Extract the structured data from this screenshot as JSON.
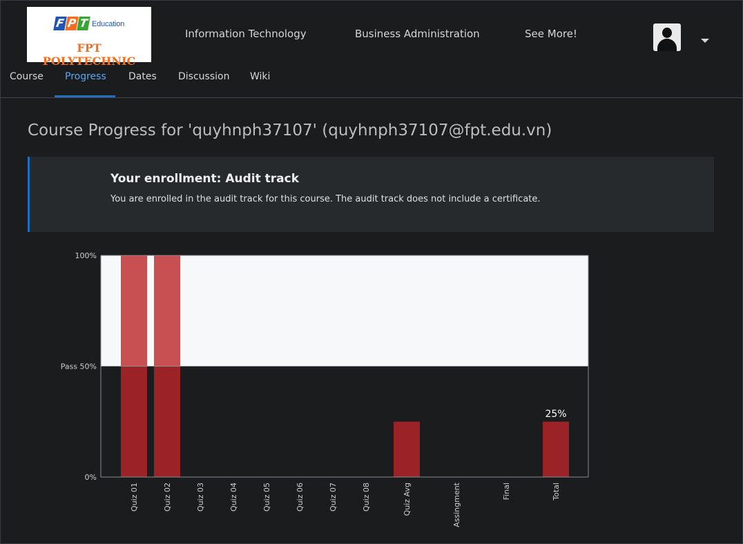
{
  "brand": {
    "letters": [
      "F",
      "P",
      "T"
    ],
    "letter_colors": [
      "#1f56b5",
      "#f26f21",
      "#3aa335"
    ],
    "education": "Education",
    "polytechnic": "FPT POLYTECHNIC"
  },
  "topnav": {
    "links": [
      "Information Technology",
      "Business Administration",
      "See More!"
    ]
  },
  "course_tabs": {
    "items": [
      "Course",
      "Progress",
      "Dates",
      "Discussion",
      "Wiki"
    ],
    "active": "Progress"
  },
  "page": {
    "title": "Course Progress for 'quyhnph37107' (quyhnph37107@fpt.edu.vn)"
  },
  "enrollment": {
    "heading": "Your enrollment: Audit track",
    "message": "You are enrolled in the audit track for this course. The audit track does not include a certificate."
  },
  "colors": {
    "accent": "#1e6fbf",
    "bar": "#9b2226",
    "bar_above_pass": "#c85052",
    "pass_area": "#f7f8f9"
  },
  "chart_data": {
    "type": "bar",
    "categories": [
      "Quiz 01",
      "Quiz 02",
      "Quiz 03",
      "Quiz 04",
      "Quiz 05",
      "Quiz 06",
      "Quiz 07",
      "Quiz 08",
      "Quiz Avg",
      "Assingment",
      "Final",
      "Total"
    ],
    "values": [
      100,
      100,
      0,
      0,
      0,
      0,
      0,
      0,
      25,
      0,
      0,
      25
    ],
    "ylim": [
      0,
      100
    ],
    "y_ticks": [
      {
        "value": 100,
        "label": "100%"
      },
      {
        "value": 50,
        "label": "Pass 50%"
      },
      {
        "value": 0,
        "label": "0%"
      }
    ],
    "pass_threshold": 50,
    "data_labels": [
      {
        "category": "Total",
        "label": "25%"
      }
    ]
  }
}
